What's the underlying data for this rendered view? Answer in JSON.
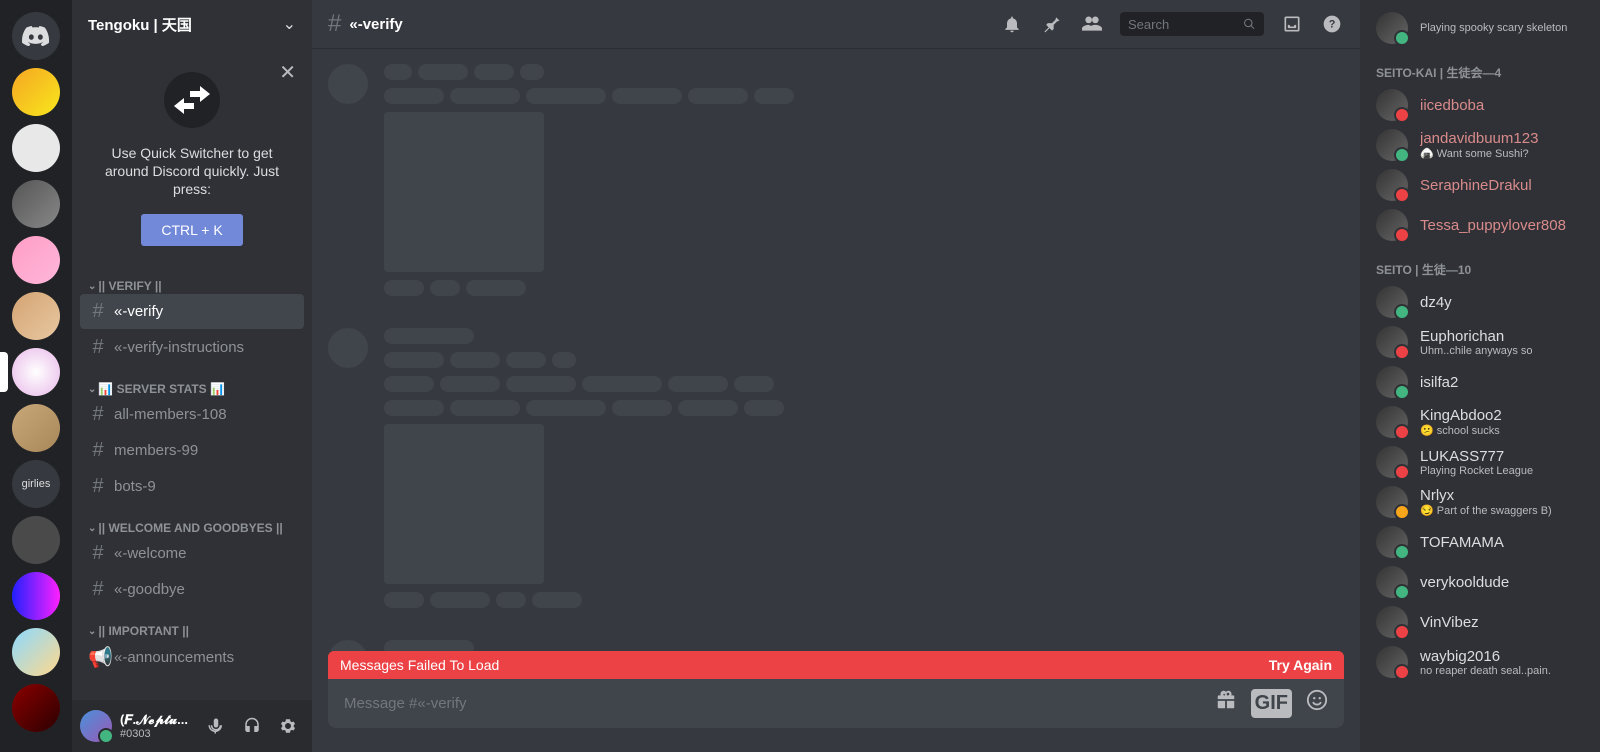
{
  "server_name": "Tengoku | 天国",
  "quick_switcher": {
    "text": "Use Quick Switcher to get around Discord quickly. Just press:",
    "btn": "CTRL + K"
  },
  "categories": [
    {
      "label": "|| VERIFY ||",
      "channels": [
        {
          "name": "«-verify",
          "active": true,
          "icon": "#"
        },
        {
          "name": "«-verify-instructions",
          "icon": "#"
        }
      ]
    },
    {
      "label": "📊 SERVER STATS 📊",
      "channels": [
        {
          "name": "all-members-108",
          "icon": "#"
        },
        {
          "name": "members-99",
          "icon": "#"
        },
        {
          "name": "bots-9",
          "icon": "#"
        }
      ]
    },
    {
      "label": "|| WELCOME AND GOODBYES ||",
      "channels": [
        {
          "name": "«-welcome",
          "icon": "#"
        },
        {
          "name": "«-goodbye",
          "icon": "#"
        }
      ]
    },
    {
      "label": "|| IMPORTANT ||",
      "channels": [
        {
          "name": "«-announcements",
          "icon": "📢"
        }
      ]
    }
  ],
  "current_channel": "«-verify",
  "user": {
    "name": "(𝑭.𝓝𝓮𝓹𝓽𝓾...",
    "tag": "#0303"
  },
  "search_placeholder": "Search",
  "error": {
    "msg": "Messages Failed To Load",
    "action": "Try Again"
  },
  "input_placeholder": "Message #«-verify",
  "partial_top": {
    "status": "Playing spooky scary skeleton"
  },
  "member_groups": [
    {
      "title": "SEITO-KAI | 生徒会—4",
      "members": [
        {
          "name": "iicedboba",
          "color": "role-color",
          "st": "st-dnd"
        },
        {
          "name": "jandavidbuum123",
          "color": "role-color",
          "status": "🍙 Want some Sushi?",
          "st": "st-online"
        },
        {
          "name": "SeraphineDrakul",
          "color": "role-color",
          "st": "st-dnd"
        },
        {
          "name": "Tessa_puppylover808",
          "color": "role-color",
          "st": "st-dnd"
        }
      ]
    },
    {
      "title": "SEITO | 生徒—10",
      "members": [
        {
          "name": "dz4y",
          "st": "st-online"
        },
        {
          "name": "Euphorichan",
          "status": "Uhm..chile anyways so",
          "st": "st-dnd"
        },
        {
          "name": "isilfa2",
          "st": "st-online"
        },
        {
          "name": "KingAbdoo2",
          "status": "😕 school sucks",
          "st": "st-dnd"
        },
        {
          "name": "LUKASS777",
          "status": "Playing Rocket League",
          "st": "st-dnd"
        },
        {
          "name": "Nrlyx",
          "status": "😏 Part of the swaggers B)",
          "st": "st-idle"
        },
        {
          "name": "TOFAMAMA",
          "st": "st-online"
        },
        {
          "name": "verykooldude",
          "st": "st-online"
        },
        {
          "name": "VinVibez",
          "st": "st-dnd"
        },
        {
          "name": "waybig2016",
          "status": "no reaper death seal..pain.",
          "st": "st-dnd"
        }
      ]
    }
  ],
  "guilds_text": [
    "girlies"
  ]
}
